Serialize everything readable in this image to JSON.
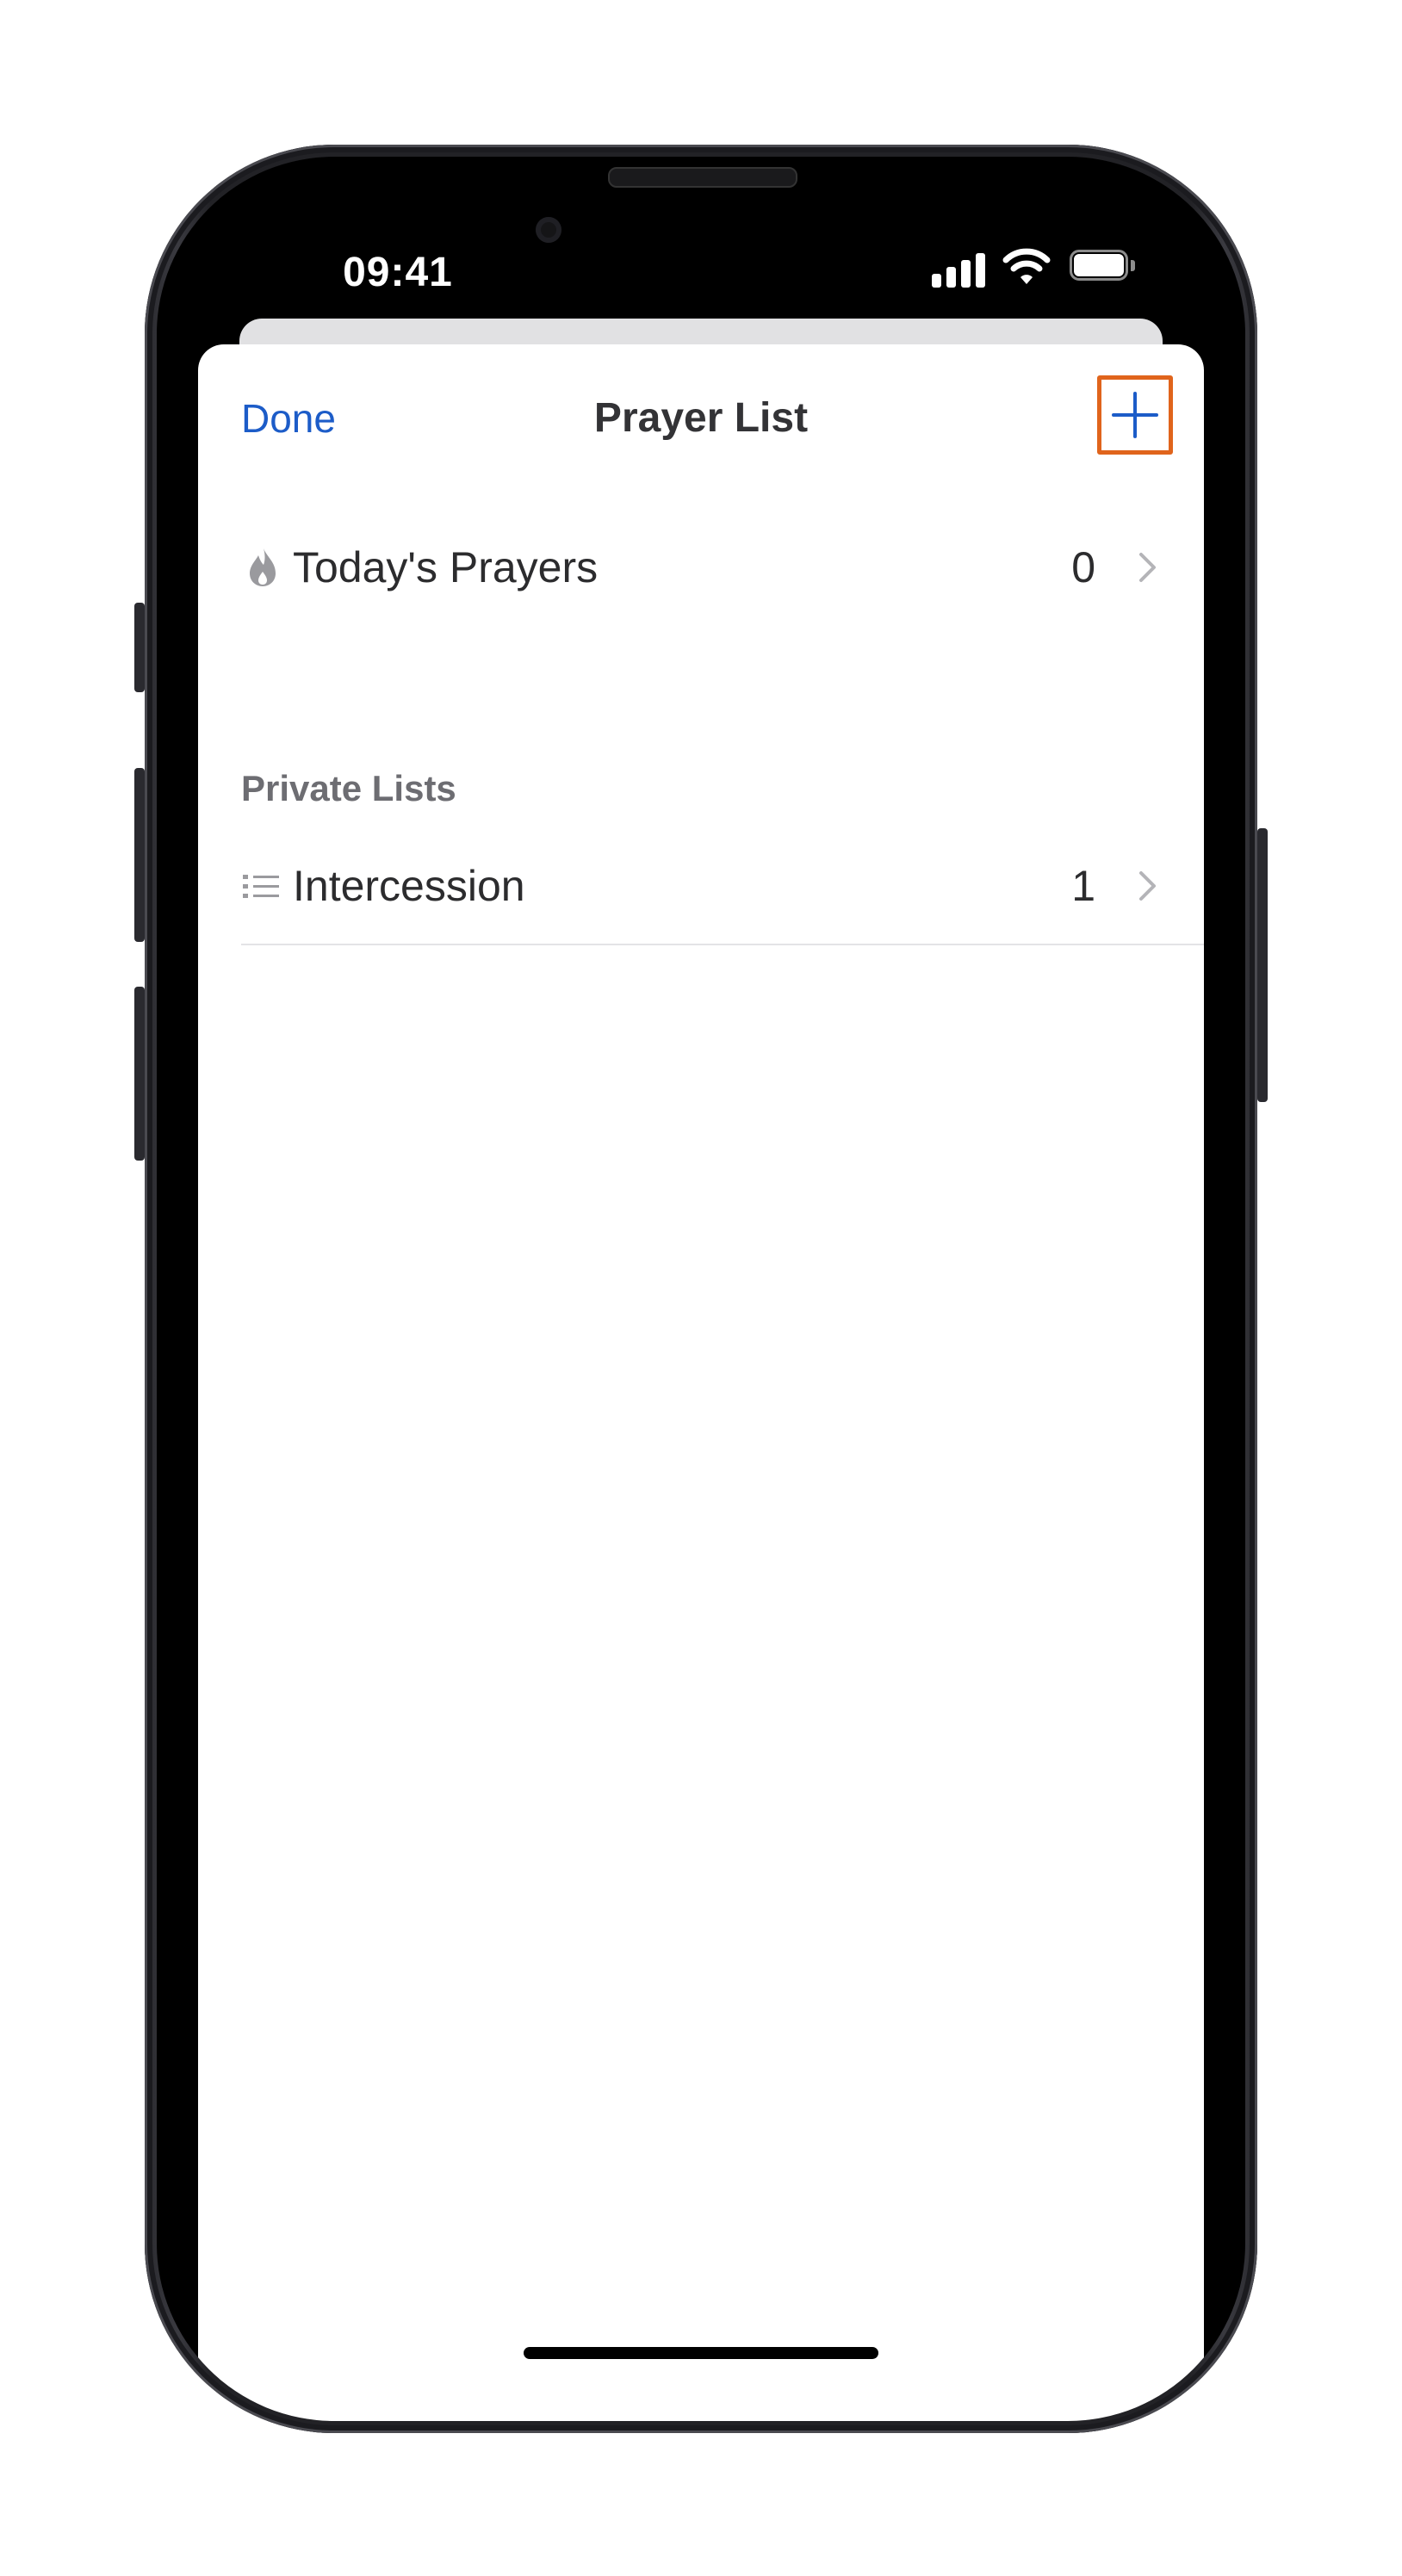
{
  "status_bar": {
    "time": "09:41"
  },
  "nav": {
    "done_label": "Done",
    "title": "Prayer List",
    "add_icon": "plus-icon"
  },
  "rows": [
    {
      "label": "Today's Prayers",
      "count": "0",
      "icon": "flame-icon"
    }
  ],
  "section": {
    "header": "Private Lists"
  },
  "private_lists": [
    {
      "label": "Intercession",
      "count": "1",
      "icon": "list-icon"
    }
  ],
  "colors": {
    "accent": "#1c5cc8",
    "highlight": "#e0641c",
    "title_text": "#333336",
    "secondary_text": "#6d6d72"
  }
}
